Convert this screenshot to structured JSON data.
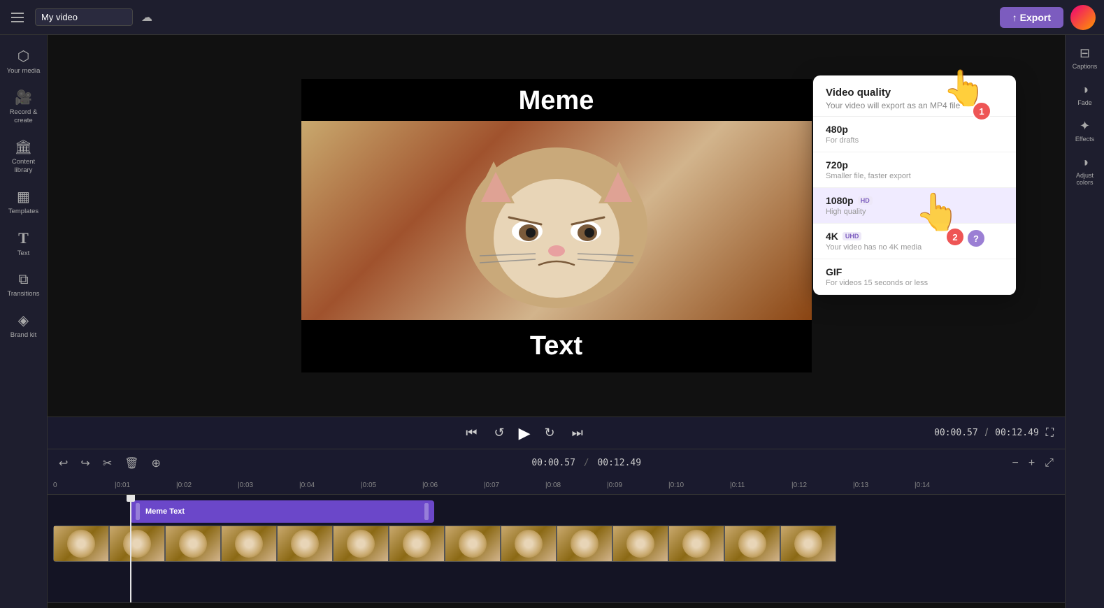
{
  "topbar": {
    "hamburger_label": "menu",
    "video_title": "My video",
    "save_icon": "☁",
    "export_label": "↑ Export"
  },
  "sidebar_left": {
    "items": [
      {
        "id": "your-media",
        "icon": "⬡",
        "label": "Your media"
      },
      {
        "id": "record-create",
        "icon": "🎬",
        "label": "Record & create"
      },
      {
        "id": "content-library",
        "icon": "🏛",
        "label": "Content library"
      },
      {
        "id": "templates",
        "icon": "▦",
        "label": "Templates"
      },
      {
        "id": "text",
        "icon": "T",
        "label": "Text"
      },
      {
        "id": "transitions",
        "icon": "⧉",
        "label": "Transitions"
      },
      {
        "id": "brand-kit",
        "icon": "⬡",
        "label": "Brand kit"
      }
    ]
  },
  "preview": {
    "top_text": "Meme",
    "bottom_text": "Text",
    "expand_icon": "⛶"
  },
  "controls": {
    "skip_back": "⏮",
    "rewind": "↺",
    "play": "▶",
    "forward": "↻",
    "skip_forward": "⏭",
    "time_current": "00:00.57",
    "time_separator": "/",
    "time_total": "00:12.49"
  },
  "timeline": {
    "undo": "↩",
    "redo": "↪",
    "cut": "✂",
    "delete": "🗑",
    "add_media": "⊕",
    "zoom_out": "−",
    "zoom_in": "+",
    "expand": "⤢",
    "markers": [
      "0",
      "|0:01",
      "|0:02",
      "|0:03",
      "|0:04",
      "|0:05",
      "|0:06",
      "|0:07",
      "|0:08",
      "|0:09",
      "|0:10",
      "|0:11",
      "|0:12",
      "|0:13",
      "|0:14"
    ],
    "text_track_label": "Meme Text"
  },
  "sidebar_right": {
    "items": [
      {
        "id": "captions",
        "icon": "⊟",
        "label": "Captions"
      },
      {
        "id": "fade",
        "icon": "◑",
        "label": "Fade"
      },
      {
        "id": "effects",
        "icon": "✦",
        "label": "Effects"
      },
      {
        "id": "adjust-colors",
        "icon": "◑",
        "label": "Adjust colors"
      }
    ]
  },
  "quality_dropdown": {
    "title": "Video quality",
    "subtitle": "Your video will export as an MP4 file",
    "options": [
      {
        "id": "480p",
        "name": "480p",
        "badge": "",
        "desc": "For drafts"
      },
      {
        "id": "720p",
        "name": "720p",
        "badge": "",
        "desc": "Smaller file, faster export"
      },
      {
        "id": "1080p",
        "name": "1080p",
        "badge": "HD",
        "desc": "High quality"
      },
      {
        "id": "4k",
        "name": "4K",
        "badge": "UHD",
        "desc": "Your video has no 4K media"
      },
      {
        "id": "gif",
        "name": "GIF",
        "badge": "",
        "desc": "For videos 15 seconds or less"
      }
    ]
  }
}
